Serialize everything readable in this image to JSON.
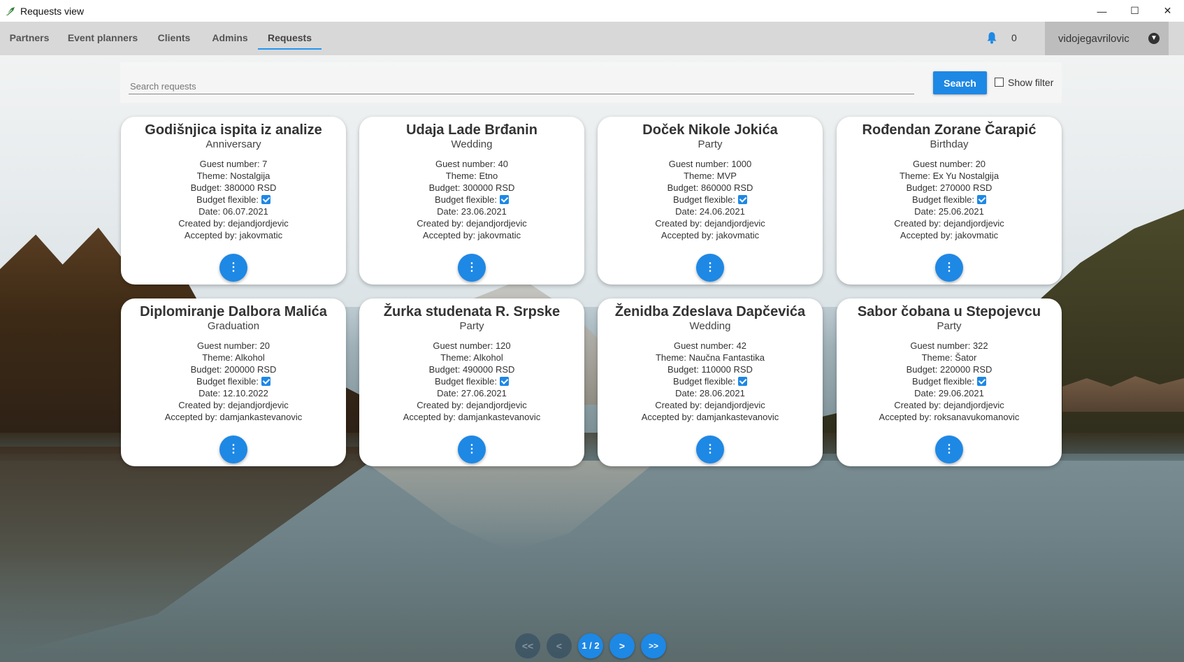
{
  "window": {
    "title": "Requests view",
    "minimize": "—",
    "maximize": "☐",
    "close": "✕"
  },
  "nav": {
    "tabs": [
      "Partners",
      "Event planners",
      "Clients",
      "Admins",
      "Requests"
    ],
    "active_tab": "Requests",
    "notification_count": "0",
    "username": "vidojegavrilovic"
  },
  "search": {
    "placeholder": "Search requests",
    "value": "",
    "button_label": "Search",
    "filter_label": "Show filter",
    "filter_checked": false
  },
  "cards": [
    {
      "title": "Godišnjica ispita iz analize",
      "type": "Anniversary",
      "guest": "Guest number: 7",
      "theme": "Theme: Nostalgija",
      "budget": "Budget: 380000 RSD",
      "flex": "Budget flexible:",
      "date": "Date: 06.07.2021",
      "created": "Created by: dejandjordjevic",
      "accepted": "Accepted by: jakovmatic"
    },
    {
      "title": "Udaja Lade Brđanin",
      "type": "Wedding",
      "guest": "Guest number: 40",
      "theme": "Theme: Etno",
      "budget": "Budget: 300000 RSD",
      "flex": "Budget flexible:",
      "date": "Date: 23.06.2021",
      "created": "Created by: dejandjordjevic",
      "accepted": "Accepted by: jakovmatic"
    },
    {
      "title": "Doček Nikole Jokića",
      "type": "Party",
      "guest": "Guest number: 1000",
      "theme": "Theme: MVP",
      "budget": "Budget: 860000 RSD",
      "flex": "Budget flexible:",
      "date": "Date: 24.06.2021",
      "created": "Created by: dejandjordjevic",
      "accepted": "Accepted by: jakovmatic"
    },
    {
      "title": "Rođendan Zorane Čarapić",
      "type": "Birthday",
      "guest": "Guest number: 20",
      "theme": "Theme: Ex Yu Nostalgija",
      "budget": "Budget: 270000 RSD",
      "flex": "Budget flexible:",
      "date": "Date: 25.06.2021",
      "created": "Created by: dejandjordjevic",
      "accepted": "Accepted by: jakovmatic"
    },
    {
      "title": "Diplomiranje Dalbora Malića",
      "type": "Graduation",
      "guest": "Guest number: 20",
      "theme": "Theme: Alkohol",
      "budget": "Budget: 200000 RSD",
      "flex": "Budget flexible:",
      "date": "Date: 12.10.2022",
      "created": "Created by: dejandjordjevic",
      "accepted": "Accepted by: damjankastevanovic"
    },
    {
      "title": "Žurka studenata R. Srpske",
      "type": "Party",
      "guest": "Guest number: 120",
      "theme": "Theme: Alkohol",
      "budget": "Budget: 490000 RSD",
      "flex": "Budget flexible:",
      "date": "Date: 27.06.2021",
      "created": "Created by: dejandjordjevic",
      "accepted": "Accepted by: damjankastevanovic"
    },
    {
      "title": "Ženidba Zdeslava Dapčevića",
      "type": "Wedding",
      "guest": "Guest number: 42",
      "theme": "Theme: Naučna Fantastika",
      "budget": "Budget: 110000 RSD",
      "flex": "Budget flexible:",
      "date": "Date: 28.06.2021",
      "created": "Created by: dejandjordjevic",
      "accepted": "Accepted by: damjankastevanovic"
    },
    {
      "title": "Sabor čobana u Stepojevcu",
      "type": "Party",
      "guest": "Guest number: 322",
      "theme": "Theme: Šator",
      "budget": "Budget: 220000 RSD",
      "flex": "Budget flexible:",
      "date": "Date: 29.06.2021",
      "created": "Created by: dejandjordjevic",
      "accepted": "Accepted by: roksanavukomanovic"
    }
  ],
  "card_button_icon": "⋮",
  "pagination": {
    "first": "<<",
    "prev": "<",
    "page": "1 / 2",
    "next": ">",
    "last": ">>"
  },
  "colors": {
    "accent": "#1e88e5"
  }
}
